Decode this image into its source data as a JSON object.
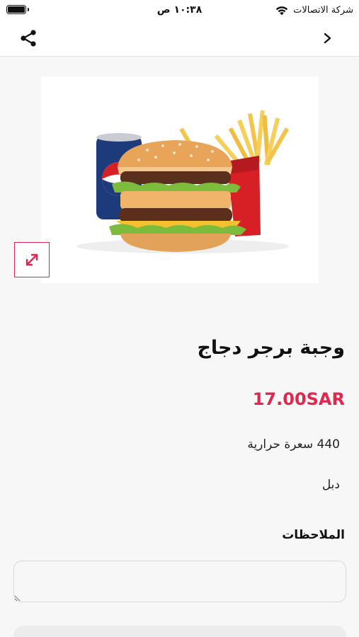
{
  "status_bar": {
    "carrier": "شركة الاتصالات",
    "time": "١٠:٣٨ ص"
  },
  "nav": {
    "share_icon": "share-icon",
    "back_icon": "chevron-right-icon"
  },
  "product": {
    "image_alt": "",
    "name": "وجبة برجر دجاج",
    "price": "17.00SAR",
    "calories": "440 سعرة حرارية",
    "variant": "دبل"
  },
  "notes": {
    "label": "الملاحظات",
    "placeholder": "",
    "value": ""
  },
  "colors": {
    "accent": "#e2264d",
    "background": "#f7f7f7"
  }
}
